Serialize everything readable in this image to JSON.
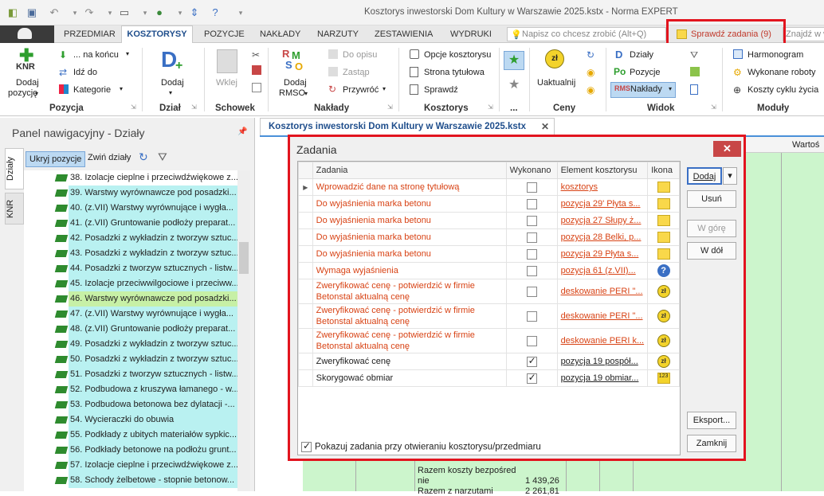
{
  "window": {
    "title": "Kosztorys inwestorski Dom Kultury w Warszawie 2025.kstx - Norma EXPERT"
  },
  "ribbon_tabs": [
    "PRZEDMIAR",
    "KOSZTORYSY",
    "POZYCJE",
    "NAKŁADY",
    "NARZUTY",
    "ZESTAWIENIA",
    "WYDRUKI"
  ],
  "search": {
    "placeholder": "Napisz co chcesz zrobić (Alt+Q)"
  },
  "check_tasks": "Sprawdź zadania (9)",
  "find": {
    "placeholder": "Znajdź w w"
  },
  "ribbon": {
    "pozycja": {
      "add_pos": "Dodaj",
      "add_pos2": "pozycję",
      "knr": "KNR",
      "na_koncu": "... na końcu",
      "idz_do": "Idź do",
      "kategorie": "Kategorie",
      "group": "Pozycja"
    },
    "dzial": {
      "add": "Dodaj",
      "group": "Dział"
    },
    "schowek": {
      "wklej": "Wklej",
      "group": "Schowek"
    },
    "naklady": {
      "add_rmso": "Dodaj",
      "add_rmso2": "RMSO",
      "do_opisu": "Do opisu",
      "zastap": "Zastąp",
      "przywroc": "Przywróć",
      "group": "Nakłady"
    },
    "kosztorys": {
      "opcje": "Opcje kosztorysu",
      "strona": "Strona tytułowa",
      "sprawdz": "Sprawdź",
      "group": "Kosztorys"
    },
    "more_group": "...",
    "ceny": {
      "aktualnij": "Uaktualnij",
      "group": "Ceny"
    },
    "widok": {
      "dzialy": "Działy",
      "pozycje": "Pozycje",
      "naklady": "Nakłady",
      "group": "Widok"
    },
    "moduly": {
      "harmonogram": "Harmonogram",
      "roboty": "Wykonane roboty",
      "koszty": "Koszty cyklu życia",
      "group": "Moduły"
    }
  },
  "nav": {
    "title": "Panel nawigacyjny - Działy",
    "side_tabs": [
      "Działy",
      "KNR"
    ],
    "hide_btn": "Ukryj pozycje",
    "collapse_btn": "Zwiń działy",
    "items": [
      {
        "label": "38. Izolacje cieplne i przeciwdźwiękowe z..."
      },
      {
        "label": "39. Warstwy wyrównawcze pod posadzki..."
      },
      {
        "label": "40. (z.VII) Warstwy wyrównujące i wygła..."
      },
      {
        "label": "41. (z.VII) Gruntowanie podłoży preparat..."
      },
      {
        "label": "42. Posadzki z wykładzin z tworzyw sztuc..."
      },
      {
        "label": "43. Posadzki z wykładzin z tworzyw sztuc..."
      },
      {
        "label": "44. Posadzki z tworzyw sztucznych - listw..."
      },
      {
        "label": "45. Izolacje przeciwwilgociowe i przeciww..."
      },
      {
        "label": "46. Warstwy wyrównawcze pod posadzki..."
      },
      {
        "label": "47. (z.VII) Warstwy wyrównujące i wygła..."
      },
      {
        "label": "48. (z.VII) Gruntowanie podłoży preparat..."
      },
      {
        "label": "49. Posadzki z wykładzin z tworzyw sztuc..."
      },
      {
        "label": "50. Posadzki z wykładzin z tworzyw sztuc..."
      },
      {
        "label": "51. Posadzki z tworzyw sztucznych - listw..."
      },
      {
        "label": "52. Podbudowa z kruszywa łamanego - w..."
      },
      {
        "label": "53. Podbudowa betonowa bez dylatacji -..."
      },
      {
        "label": "54. Wycieraczki do obuwia"
      },
      {
        "label": "55. Podkłady z ubitych materiałów sypkic..."
      },
      {
        "label": "56. Podkłady betonowe na podłożu grunt..."
      },
      {
        "label": "57. Izolacje cieplne i przeciwdźwiękowe z..."
      },
      {
        "label": "58. Schody żelbetowe - stopnie betonow..."
      }
    ]
  },
  "doc": {
    "tab": "Kosztorys inwestorski Dom Kultury w Warszawie 2025.kstx",
    "col_header": "Wartoś"
  },
  "dialog": {
    "title": "Zadania",
    "columns": [
      "Zadania",
      "Wykonano",
      "Element kosztorysu",
      "Ikona"
    ],
    "rows": [
      {
        "task": "Wprowadzić dane na stronę tytułową",
        "done": false,
        "element": "kosztorys"
      },
      {
        "task": "Do wyjaśnienia marka betonu",
        "done": false,
        "element": "pozycja 29' Płyta s..."
      },
      {
        "task": "Do wyjaśnienia marka betonu",
        "done": false,
        "element": "pozycja 27 Słupy ż..."
      },
      {
        "task": "Do wyjaśnienia marka betonu",
        "done": false,
        "element": "pozycja 28 Belki, p..."
      },
      {
        "task": "Do wyjaśnienia marka betonu",
        "done": false,
        "element": "pozycja 29 Płyta s..."
      },
      {
        "task": "Wymaga wyjaśnienia",
        "done": false,
        "element": "pozycja 61 (z.VII)..."
      },
      {
        "task": "Zweryfikować cenę - potwierdzić w firmie Betonstal aktualną cenę",
        "done": false,
        "element": "deskowanie PERI \"..."
      },
      {
        "task": "Zweryfikować cenę - potwierdzić w firmie Betonstal aktualną cenę",
        "done": false,
        "element": "deskowanie PERI \"..."
      },
      {
        "task": "Zweryfikować cenę - potwierdzić w firmie Betonstal aktualną cenę",
        "done": false,
        "element": "deskowanie PERI k..."
      },
      {
        "task": "Zweryfikować cenę",
        "done": true,
        "element": "pozycja 19 pospół..."
      },
      {
        "task": "Skorygować obmiar",
        "done": true,
        "element": "pozycja 19 obmiar..."
      }
    ],
    "buttons": {
      "add": "Dodaj",
      "remove": "Usuń",
      "up": "W górę",
      "down": "W dół",
      "export": "Eksport...",
      "close": "Zamknij"
    },
    "show_on_open": "Pokazuj zadania przy otwieraniu kosztorysu/przedmiaru"
  },
  "bottom": {
    "label1": "Razem koszty bezpośred",
    "label1b": "nie",
    "value1": "1 439,26",
    "label2": "Razem z narzutami",
    "value2": "2 261,81"
  }
}
